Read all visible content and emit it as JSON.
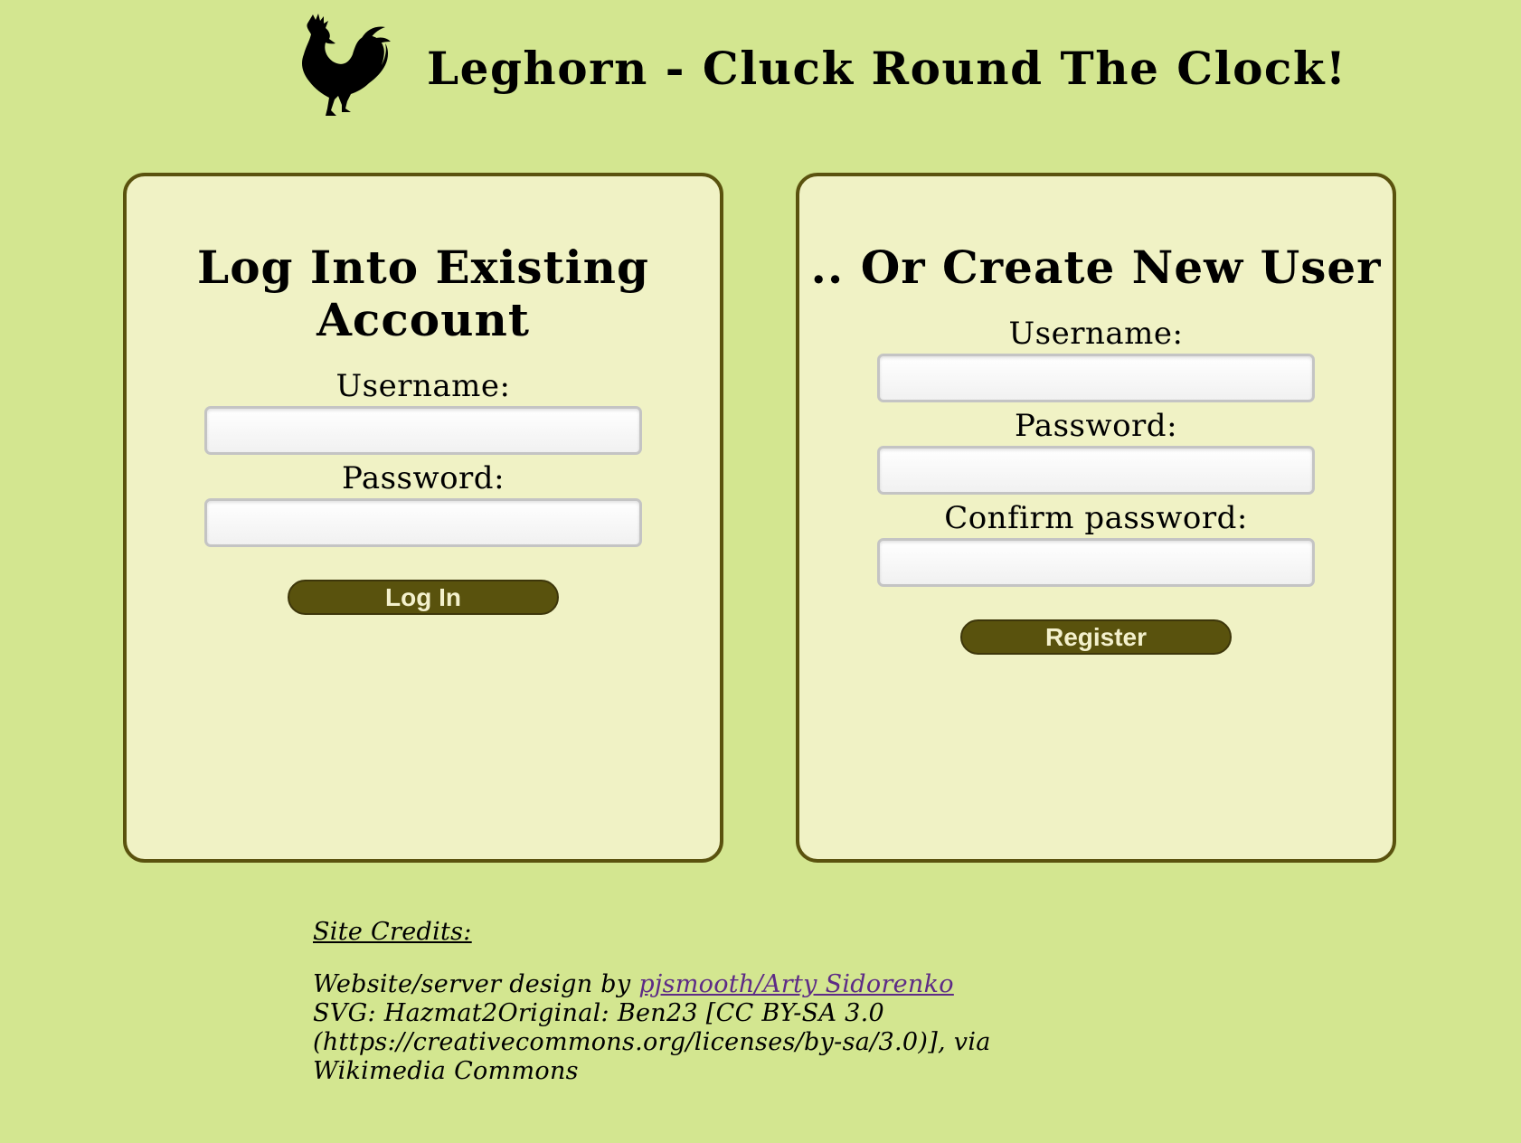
{
  "header": {
    "title": "Leghorn - Cluck Round The Clock!",
    "logo_icon": "rooster-icon"
  },
  "login": {
    "title": "Log Into Existing Account",
    "username_label": "Username:",
    "username_value": "",
    "password_label": "Password:",
    "password_value": "",
    "button_label": "Log In"
  },
  "register": {
    "title": ".. Or Create New User",
    "username_label": "Username:",
    "username_value": "",
    "password_label": "Password:",
    "password_value": "",
    "confirm_label": "Confirm password:",
    "confirm_value": "",
    "button_label": "Register"
  },
  "credits": {
    "heading": "Site Credits:",
    "design_prefix": "Website/server design by ",
    "design_link": "pjsmooth/Arty Sidorenko",
    "svg_line": "SVG: Hazmat2Original: Ben23 [CC BY-SA 3.0 (https://creativecommons.org/licenses/by-sa/3.0)], via Wikimedia Commons"
  },
  "colors": {
    "background": "#d3e690",
    "card": "#f0f2c5",
    "card_border": "#5a520e",
    "button": "#59520d",
    "button_text": "#f3f0cc",
    "link": "#5d2b86"
  }
}
